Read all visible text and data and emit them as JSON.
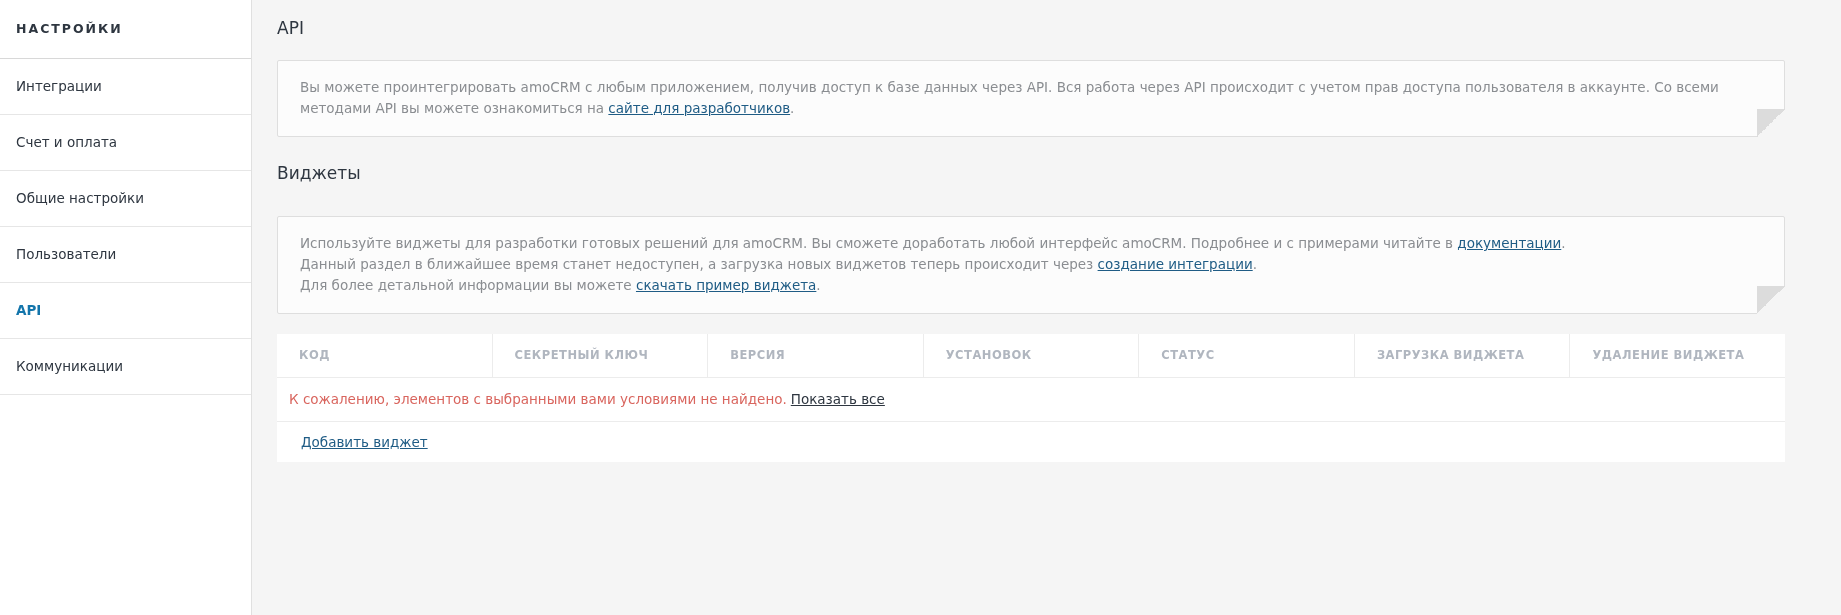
{
  "sidebar": {
    "title": "НАСТРОЙКИ",
    "items": [
      {
        "label": "Интеграции",
        "selected": false
      },
      {
        "label": "Счет и оплата",
        "selected": false
      },
      {
        "label": "Общие настройки",
        "selected": false
      },
      {
        "label": "Пользователи",
        "selected": false
      },
      {
        "label": "API",
        "selected": true
      },
      {
        "label": "Коммуникации",
        "selected": false
      }
    ]
  },
  "sections": [
    {
      "title": "API",
      "paragraphs": [
        [
          {
            "kind": "text",
            "text": "Вы можете проинтегрировать amoCRM с любым приложением, получив доступ к базе данных через API. Вся работа через API происходит с учетом прав доступа пользователя в аккаунте. Со всеми методами API вы можете ознакомиться на "
          },
          {
            "kind": "link",
            "text": "сайте для разработчиков"
          },
          {
            "kind": "text",
            "text": "."
          }
        ]
      ]
    },
    {
      "title": "Виджеты",
      "paragraphs": [
        [
          {
            "kind": "text",
            "text": "Используйте виджеты для разработки готовых решений для amoCRM. Вы сможете доработать любой интерфейс amoCRM. Подробнее и с примерами читайте в "
          },
          {
            "kind": "link",
            "text": "документации"
          },
          {
            "kind": "text",
            "text": "."
          }
        ],
        [
          {
            "kind": "text",
            "text": "Данный раздел в ближайшее время станет недоступен, а загрузка новых виджетов теперь происходит через "
          },
          {
            "kind": "link",
            "text": "создание интеграции"
          },
          {
            "kind": "text",
            "text": "."
          }
        ],
        [
          {
            "kind": "text",
            "text": "Для более детальной информации вы можете "
          },
          {
            "kind": "link",
            "text": "скачать пример виджета"
          },
          {
            "kind": "text",
            "text": "."
          }
        ]
      ]
    }
  ],
  "table": {
    "columns": [
      "КОД",
      "СЕКРЕТНЫЙ КЛЮЧ",
      "ВЕРСИЯ",
      "УСТАНОВОК",
      "СТАТУС",
      "ЗАГРУЗКА ВИДЖЕТА",
      "УДАЛЕНИЕ ВИДЖЕТА"
    ],
    "empty_message": "К сожалению, элементов с выбранными вами условиями не найдено.",
    "show_all_link": "Показать все",
    "add_link": "Добавить виджет"
  }
}
